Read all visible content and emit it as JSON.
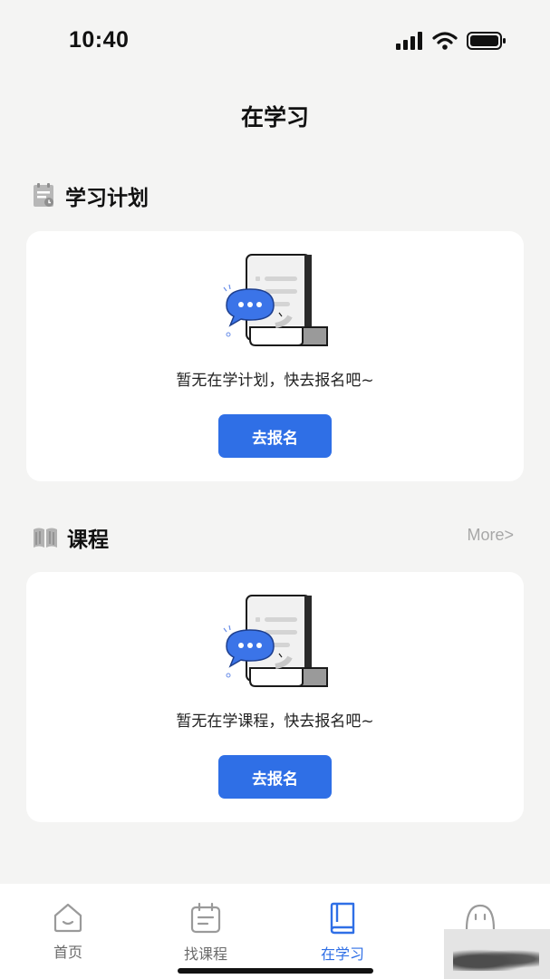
{
  "status": {
    "time": "10:40"
  },
  "page": {
    "title": "在学习"
  },
  "plan_section": {
    "title": "学习计划",
    "empty_text": "暂无在学计划，快去报名吧~",
    "button_label": "去报名"
  },
  "course_section": {
    "title": "课程",
    "more_label": "More>",
    "empty_text": "暂无在学课程，快去报名吧~",
    "button_label": "去报名"
  },
  "tabs": [
    {
      "label": "首页",
      "icon": "home-icon"
    },
    {
      "label": "找课程",
      "icon": "calendar-icon"
    },
    {
      "label": "在学习",
      "icon": "book-icon",
      "active": true
    },
    {
      "label": "",
      "icon": "profile-face-icon"
    }
  ],
  "colors": {
    "accent": "#2f6fe6",
    "background": "#f4f4f3",
    "card": "#ffffff",
    "muted": "#a7a7a7"
  }
}
